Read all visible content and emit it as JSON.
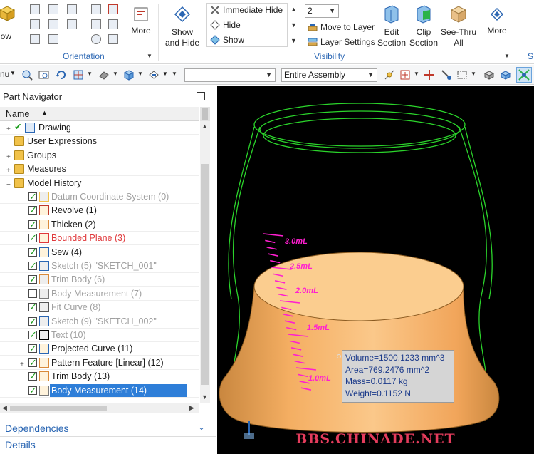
{
  "ribbon": {
    "window_label": "dow",
    "orientation_more": "More",
    "orientation_group": "Orientation",
    "show_and_hide": "Show\nand Hide",
    "immediate_hide": "Immediate Hide",
    "hide": "Hide",
    "show": "Show",
    "layer_combo_value": "2",
    "move_to_layer": "Move to Layer",
    "layer_settings": "Layer Settings",
    "edit_section": "Edit\nSection",
    "clip_section": "Clip\nSection",
    "see_thru_all": "See-Thru\nAll",
    "visibility_more": "More",
    "visibility_group": "Visibility",
    "last_group_partial": "S"
  },
  "toolbar": {
    "menu_partial": "nu",
    "filter_combo_value": "",
    "scope_combo_value": "Entire Assembly"
  },
  "navigator": {
    "title": "Part Navigator",
    "column_name": "Name",
    "items": [
      {
        "label": "Drawing",
        "style": "normal",
        "expand": "+"
      },
      {
        "label": "User Expressions",
        "style": "normal",
        "expand": ""
      },
      {
        "label": "Groups",
        "style": "normal",
        "expand": "+"
      },
      {
        "label": "Measures",
        "style": "normal",
        "expand": "+"
      },
      {
        "label": "Model History",
        "style": "normal",
        "expand": "−"
      },
      {
        "label": "Datum Coordinate System (0)",
        "style": "grey",
        "checked": true
      },
      {
        "label": "Revolve (1)",
        "style": "normal",
        "checked": true
      },
      {
        "label": "Thicken (2)",
        "style": "normal",
        "checked": true
      },
      {
        "label": "Bounded Plane (3)",
        "style": "red",
        "checked": true
      },
      {
        "label": "Sew (4)",
        "style": "normal",
        "checked": true
      },
      {
        "label": "Sketch (5) \"SKETCH_001\"",
        "style": "grey",
        "checked": true
      },
      {
        "label": "Trim Body (6)",
        "style": "grey",
        "checked": true
      },
      {
        "label": "Body Measurement (7)",
        "style": "grey",
        "checked": false
      },
      {
        "label": "Fit Curve (8)",
        "style": "grey",
        "checked": true
      },
      {
        "label": "Sketch (9) \"SKETCH_002\"",
        "style": "grey",
        "checked": true
      },
      {
        "label": "Text (10)",
        "style": "grey",
        "checked": true
      },
      {
        "label": "Projected Curve (11)",
        "style": "normal",
        "checked": true
      },
      {
        "label": "Pattern Feature [Linear] (12)",
        "style": "normal",
        "checked": true,
        "expand": "+"
      },
      {
        "label": "Trim Body (13)",
        "style": "normal",
        "checked": true
      },
      {
        "label": "Body Measurement (14)",
        "style": "selected",
        "checked": true
      }
    ],
    "dependencies": "Dependencies",
    "details": "Details"
  },
  "viewport": {
    "scale_labels": [
      "3.0mL",
      "2.5mL",
      "2.0mL",
      "1.5mL",
      "1.0mL"
    ],
    "measurement": {
      "volume": "Volume=1500.1233 mm^3",
      "area": "Area=769.2476 mm^2",
      "mass": "Mass=0.0117 kg",
      "weight": "Weight=0.1152 N"
    },
    "watermark": "BBS.CHINADE.NET"
  },
  "colors": {
    "accent": "#2a66b3",
    "selection": "#2e7ed8",
    "error_red": "#e0383b",
    "wireframe_green": "#2bd42b",
    "scale_magenta": "#ff1fd0",
    "body_orange": "#f5b266"
  }
}
